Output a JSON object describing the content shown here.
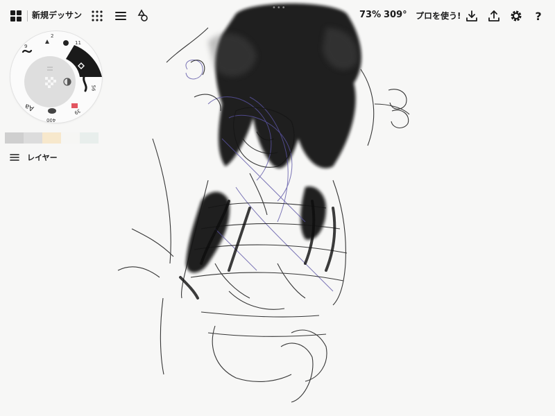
{
  "header": {
    "title": "新規デッサン",
    "zoom": "73%",
    "rotation": "309°",
    "pro_label": "プロを使う!",
    "handle": "•••"
  },
  "icons": {
    "gallery": "gallery-grid-icon",
    "brushes": "brush-grid-icon",
    "layers": "layers-icon",
    "shapes": "shapes-icon",
    "export": "download-icon",
    "share": "share-icon",
    "settings": "gear-icon",
    "help": "help-icon",
    "undo": "undo-icon",
    "redo": "redo-icon"
  },
  "tool_wheel": {
    "labels": [
      "9",
      "2",
      "11",
      "56",
      "39",
      "400",
      "Aa"
    ],
    "undo": "↶",
    "redo": "↷"
  },
  "swatches": [
    "#cfcfcf",
    "#dcdcdc",
    "#f7e8cc",
    "#f6f6f4",
    "#e8eeec"
  ],
  "layers": {
    "label": "レイヤー"
  },
  "colors": {
    "ink": "#111111",
    "accent_pen": "#5b54a6",
    "wash": "#1a1a1a"
  }
}
